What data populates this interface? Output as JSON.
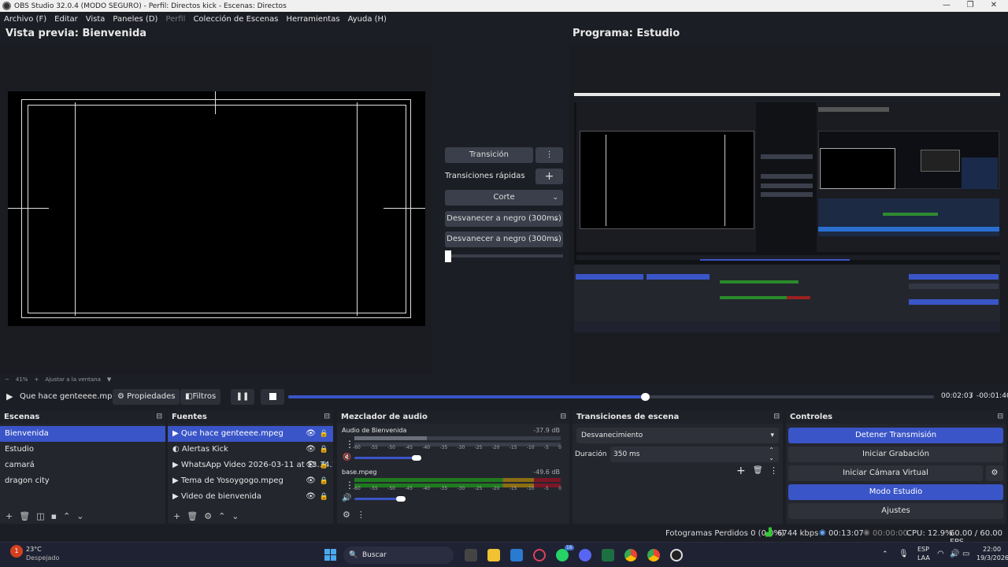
{
  "window": {
    "title": "OBS Studio 32.0.4 (MODO SEGURO) - Perfil: Directos kick - Escenas: Directos",
    "minimize": "—",
    "maximize": "❐",
    "close": "✕"
  },
  "menu": [
    "Archivo (F)",
    "Editar",
    "Vista",
    "Paneles (D)",
    "Perfil",
    "Colección de Escenas",
    "Herramientas",
    "Ayuda (H)"
  ],
  "preview": {
    "title": "Vista previa: Bienvenida",
    "zoom": "41%",
    "zoom_minus": "−",
    "zoom_plus": "+",
    "fit": "Ajustar a la ventana"
  },
  "program": {
    "title": "Programa: Estudio"
  },
  "transitions_panel": {
    "transition_btn": "Transición",
    "quick_label": "Transiciones rápidas",
    "items": [
      "Corte",
      "Desvanecer a negro (300ms)",
      "Desvanecer a negro (300ms)"
    ]
  },
  "media": {
    "name": "Que hace genteeee.mpeg",
    "props": "Propiedades",
    "filters": "Filtros",
    "time_elapsed": "00:02:03",
    "separator": "/",
    "time_remaining": "-00:01:40",
    "progress": 0.553
  },
  "scenes": {
    "title": "Escenas",
    "items": [
      "Bienvenida",
      "Estudio",
      "camará",
      "dragon city"
    ],
    "selected": 0
  },
  "sources": {
    "title": "Fuentes",
    "items": [
      "Que hace genteeee.mpeg",
      "Alertas Kick",
      "WhatsApp Video 2026-03-11 at 13.34.1",
      "Tema de Yosoygogo.mpeg",
      "Video de bienvenida"
    ],
    "selected": 0
  },
  "mixer": {
    "title": "Mezclador de audio",
    "scale": [
      "-60",
      "-55",
      "-50",
      "-45",
      "-40",
      "-35",
      "-30",
      "-25",
      "-20",
      "-15",
      "-10",
      "-5",
      "0"
    ],
    "channels": [
      {
        "name": "Audio de Bienvenida",
        "db": "-37.9 dB",
        "volume": 0.75
      },
      {
        "name": "base.mpeg",
        "db": "-49.6 dB",
        "volume": 0.55
      }
    ]
  },
  "scene_transitions": {
    "title": "Transiciones de escena",
    "selected": "Desvanecimiento",
    "duration_label": "Duración",
    "duration_value": "350 ms"
  },
  "controls": {
    "title": "Controles",
    "buttons": [
      "Detener Transmisión",
      "Iniciar Grabación",
      "Iniciar Cámara Virtual",
      "Modo Estudio",
      "Ajustes"
    ]
  },
  "status": {
    "dropped": "Fotogramas Perdidos 0 (0,0%)",
    "bitrate": "6744 kbps",
    "live_time": "00:13:07",
    "rec_time": "00:00:00",
    "cpu": "CPU: 12.9%",
    "fps": "60.00 / 60.00 FPS"
  },
  "taskbar": {
    "temp": "23°C",
    "weather": "Despejado",
    "search": "Buscar",
    "lang1": "ESP",
    "lang2": "LAA",
    "time": "22:00",
    "date": "19/3/2026",
    "badge": "1",
    "notif": "16"
  }
}
